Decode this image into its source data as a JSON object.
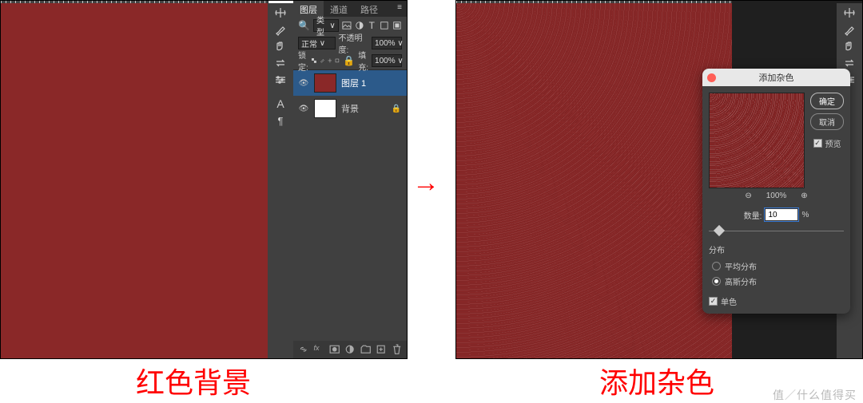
{
  "arrow": "→",
  "captions": {
    "left": "红色背景",
    "right": "添加杂色"
  },
  "watermark": "值／什么值得买",
  "tool_icons": [
    "arrows-icon",
    "brush-icon",
    "hand-icon",
    "swap-icon",
    "slider-icon",
    "divider",
    "type-icon",
    "paragraph-icon"
  ],
  "right_tool_icons": [
    "arrows-icon",
    "brush-icon",
    "hand-icon",
    "swap-icon",
    "slider-icon"
  ],
  "layers_panel": {
    "tabs": [
      "图层",
      "通道",
      "路径"
    ],
    "menu_glyph": "≡",
    "type_row": {
      "search_glyph": "🔍",
      "kind_label": "类型",
      "kind_caret": "∨",
      "icons": [
        "image-icon",
        "adjust-icon",
        "type-filter-icon",
        "shape-icon",
        "smart-icon"
      ]
    },
    "blend_row": {
      "mode": "正常",
      "mode_caret": "∨",
      "opacity_label": "不透明度:",
      "opacity_value": "100%",
      "opacity_caret": "∨"
    },
    "lock_row": {
      "lock_label": "锁定:",
      "icons": [
        "lock-trans-icon",
        "lock-pixel-icon",
        "lock-pos-icon",
        "lock-artboard-icon",
        "lock-all-icon"
      ],
      "fill_label": "填充:",
      "fill_value": "100%",
      "fill_caret": "∨"
    },
    "layers": [
      {
        "visible": "👁",
        "name": "图层 1",
        "thumb": "red",
        "locked": ""
      },
      {
        "visible": "👁",
        "name": "背景",
        "thumb": "white",
        "locked": "🔒"
      }
    ],
    "bottom_icons": [
      "link-icon",
      "fx-icon",
      "mask-icon",
      "fill-adj-icon",
      "group-icon",
      "new-icon",
      "trash-icon"
    ]
  },
  "dialog": {
    "title": "添加杂色",
    "ok": "确定",
    "cancel": "取消",
    "preview_chk": "预览",
    "zoom": {
      "out": "⊖",
      "pct": "100%",
      "in": "⊕"
    },
    "amount_label": "数量:",
    "amount_value": "10",
    "amount_unit": "%",
    "dist_label": "分布",
    "dist_uniform": "平均分布",
    "dist_gaussian": "高斯分布",
    "mono": "单色"
  }
}
